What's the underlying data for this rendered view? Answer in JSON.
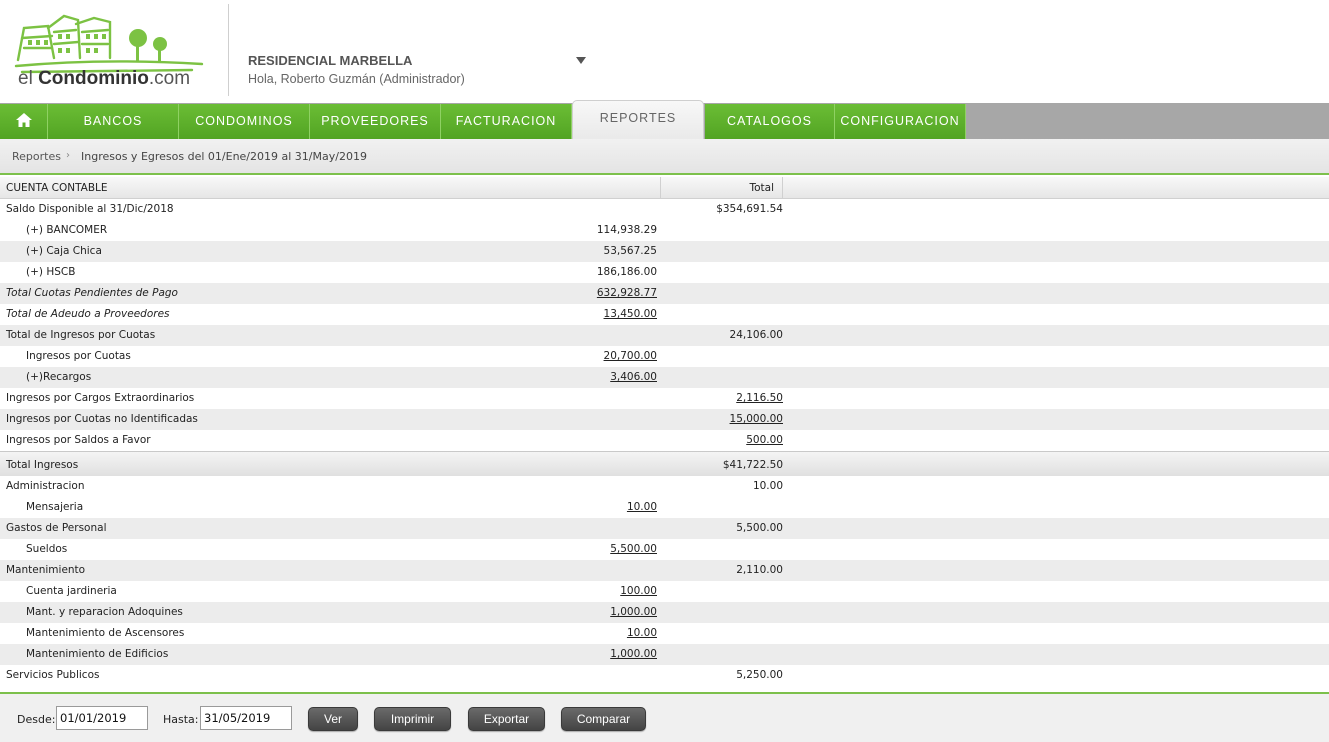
{
  "header": {
    "logo_text_light": "el ",
    "logo_text_bold": "Condominio",
    "logo_text_suffix": ".com",
    "condo_name": "RESIDENCIAL MARBELLA",
    "greeting": "Hola, Roberto Guzmán (Administrador)"
  },
  "nav": {
    "items": [
      {
        "label": "BANCOS"
      },
      {
        "label": "CONDOMINOS"
      },
      {
        "label": "PROVEEDORES"
      },
      {
        "label": "FACTURACION"
      },
      {
        "label": "REPORTES"
      },
      {
        "label": "CATALOGOS"
      },
      {
        "label": "CONFIGURACION"
      }
    ]
  },
  "breadcrumb": {
    "root": "Reportes",
    "current": "Ingresos y Egresos del 01/Ene/2019 al 31/May/2019"
  },
  "table": {
    "col_account": "CUENTA CONTABLE",
    "col_total": "Total",
    "rows": [
      {
        "label": "Saldo Disponible al 31/Dic/2018",
        "amount": "",
        "total": "$354,691.54"
      },
      {
        "label": "(+) BANCOMER",
        "amount": "114,938.29",
        "total": ""
      },
      {
        "label": "(+) Caja Chica",
        "amount": "53,567.25",
        "total": ""
      },
      {
        "label": "(+) HSCB",
        "amount": "186,186.00",
        "total": ""
      },
      {
        "label": "Total Cuotas Pendientes de Pago",
        "amount": "632,928.77",
        "total": ""
      },
      {
        "label": "Total de Adeudo a Proveedores",
        "amount": "13,450.00",
        "total": ""
      },
      {
        "label": "Total de Ingresos por Cuotas",
        "amount": "",
        "total": "24,106.00"
      },
      {
        "label": "Ingresos por Cuotas",
        "amount": "20,700.00",
        "total": ""
      },
      {
        "label": "(+)Recargos",
        "amount": "3,406.00",
        "total": ""
      },
      {
        "label": "Ingresos por Cargos Extraordinarios",
        "amount": "",
        "total": "2,116.50"
      },
      {
        "label": "Ingresos por Cuotas no Identificadas",
        "amount": "",
        "total": "15,000.00"
      },
      {
        "label": "Ingresos por Saldos a Favor",
        "amount": "",
        "total": "500.00"
      },
      {
        "label": "Total Ingresos",
        "amount": "",
        "total": "$41,722.50"
      },
      {
        "label": "Administracion",
        "amount": "",
        "total": "10.00"
      },
      {
        "label": "Mensajeria",
        "amount": "10.00",
        "total": ""
      },
      {
        "label": "Gastos de Personal",
        "amount": "",
        "total": "5,500.00"
      },
      {
        "label": "Sueldos",
        "amount": "5,500.00",
        "total": ""
      },
      {
        "label": "Mantenimiento",
        "amount": "",
        "total": "2,110.00"
      },
      {
        "label": "Cuenta jardineria",
        "amount": "100.00",
        "total": ""
      },
      {
        "label": "Mant. y reparacion Adoquines",
        "amount": "1,000.00",
        "total": ""
      },
      {
        "label": "Mantenimiento de Ascensores",
        "amount": "10.00",
        "total": ""
      },
      {
        "label": "Mantenimiento de Edificios",
        "amount": "1,000.00",
        "total": ""
      },
      {
        "label": "Servicios Publicos",
        "amount": "",
        "total": "5,250.00"
      }
    ]
  },
  "footer": {
    "from_label": "Desde:",
    "from_value": "01/01/2019",
    "to_label": "Hasta:",
    "to_value": "31/05/2019",
    "view_button": "Ver",
    "print_button": "Imprimir",
    "export_button": "Exportar",
    "compare_button": "Comparar"
  },
  "colors": {
    "brand_green": "#5fb12b",
    "nav_gray": "#a7a7a7",
    "row_alt": "#ececec"
  }
}
